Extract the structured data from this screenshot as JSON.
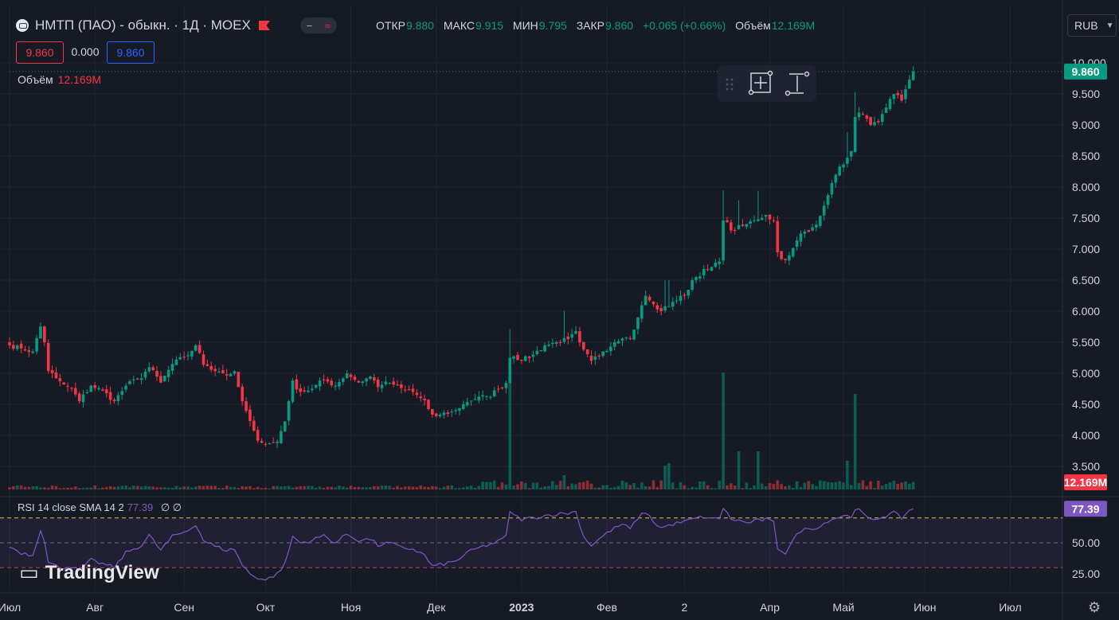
{
  "header": {
    "title": "НМТП (ПАО) - обыкн. · 1Д · MOEX",
    "indicator_pill": {
      "left_glyph": "−",
      "right_glyph": "≈"
    },
    "ohlc": {
      "open_label": "ОТКР",
      "open": "9.880",
      "high_label": "МАКС",
      "high": "9.915",
      "low_label": "МИН",
      "low": "9.795",
      "close_label": "ЗАКР",
      "close": "9.860",
      "change": "+0.065 (+0.66%)",
      "volume_label": "Объём",
      "volume": "12.169M"
    },
    "bid": "9.860",
    "spread": "0.000",
    "ask": "9.860",
    "currency": "RUB",
    "currency_icon": "chevron-down-icon"
  },
  "volume_legend": {
    "label": "Объём",
    "value": "12.169M"
  },
  "rsi_legend": {
    "text": "RSI 14 close SMA 14 2",
    "value": "77.39",
    "tail": "∅ ∅"
  },
  "branding": {
    "name": "TradingView",
    "icon": "tradingview-logo"
  },
  "colors": {
    "up": "#089981",
    "down": "#f23645",
    "rsi": "#7e57c2",
    "bg": "#161a25"
  },
  "chart_data": [
    {
      "type": "candlestick",
      "title": "НМТП (ПАО) - обыкн. · 1Д · MOEX",
      "ylim": [
        3.1,
        10.1
      ],
      "y_ticks": [
        "10.000",
        "9.500",
        "9.000",
        "8.500",
        "8.000",
        "7.500",
        "7.000",
        "6.500",
        "6.000",
        "5.500",
        "5.000",
        "4.500",
        "4.000",
        "3.500"
      ],
      "y_tick_values": [
        10,
        9.5,
        9,
        8.5,
        8,
        7.5,
        7,
        6.5,
        6,
        5.5,
        5,
        4.5,
        4,
        3.5
      ],
      "x_ticks": [
        "Июл",
        "Авг",
        "Сен",
        "Окт",
        "Ноя",
        "Дек",
        "2023",
        "Фев",
        "2",
        "Апр",
        "Май",
        "Июн",
        "Июл"
      ],
      "x_tick_days": [
        0,
        22,
        45,
        66,
        88,
        110,
        132,
        154,
        174,
        196,
        215,
        236,
        258
      ],
      "last_price_label": "9.860",
      "last_volume_label": "12.169M",
      "anchors": [
        [
          0,
          5.45
        ],
        [
          3,
          5.4
        ],
        [
          6,
          5.35
        ],
        [
          8,
          5.75
        ],
        [
          9,
          5.5
        ],
        [
          10,
          5.05
        ],
        [
          13,
          4.85
        ],
        [
          16,
          4.75
        ],
        [
          18,
          4.55
        ],
        [
          21,
          4.8
        ],
        [
          24,
          4.72
        ],
        [
          27,
          4.55
        ],
        [
          30,
          4.8
        ],
        [
          34,
          4.95
        ],
        [
          36,
          5.1
        ],
        [
          39,
          4.85
        ],
        [
          42,
          5.15
        ],
        [
          46,
          5.3
        ],
        [
          48,
          5.45
        ],
        [
          50,
          5.15
        ],
        [
          53,
          5.05
        ],
        [
          56,
          4.98
        ],
        [
          58,
          5.0
        ],
        [
          60,
          4.55
        ],
        [
          62,
          4.2
        ],
        [
          64,
          3.95
        ],
        [
          66,
          3.85
        ],
        [
          69,
          3.9
        ],
        [
          71,
          4.25
        ],
        [
          73,
          4.85
        ],
        [
          75,
          4.7
        ],
        [
          78,
          4.75
        ],
        [
          81,
          4.9
        ],
        [
          84,
          4.8
        ],
        [
          87,
          5.0
        ],
        [
          90,
          4.85
        ],
        [
          93,
          4.95
        ],
        [
          95,
          4.8
        ],
        [
          98,
          4.85
        ],
        [
          101,
          4.75
        ],
        [
          104,
          4.7
        ],
        [
          107,
          4.55
        ],
        [
          109,
          4.3
        ],
        [
          112,
          4.35
        ],
        [
          115,
          4.4
        ],
        [
          118,
          4.55
        ],
        [
          121,
          4.6
        ],
        [
          124,
          4.65
        ],
        [
          126,
          4.75
        ],
        [
          128,
          4.85
        ],
        [
          129,
          5.25
        ],
        [
          130,
          5.3
        ],
        [
          132,
          5.2
        ],
        [
          135,
          5.3
        ],
        [
          138,
          5.45
        ],
        [
          141,
          5.5
        ],
        [
          144,
          5.55
        ],
        [
          146,
          5.65
        ],
        [
          148,
          5.35
        ],
        [
          150,
          5.2
        ],
        [
          152,
          5.3
        ],
        [
          155,
          5.45
        ],
        [
          158,
          5.6
        ],
        [
          160,
          5.55
        ],
        [
          162,
          5.9
        ],
        [
          164,
          6.25
        ],
        [
          166,
          6.1
        ],
        [
          168,
          6.0
        ],
        [
          171,
          6.15
        ],
        [
          174,
          6.25
        ],
        [
          176,
          6.5
        ],
        [
          179,
          6.65
        ],
        [
          181,
          6.7
        ],
        [
          183,
          6.8
        ],
        [
          184,
          7.5
        ],
        [
          186,
          7.3
        ],
        [
          188,
          7.35
        ],
        [
          190,
          7.4
        ],
        [
          193,
          7.5
        ],
        [
          195,
          7.55
        ],
        [
          197,
          7.45
        ],
        [
          198,
          6.95
        ],
        [
          200,
          6.8
        ],
        [
          202,
          7.0
        ],
        [
          204,
          7.25
        ],
        [
          207,
          7.35
        ],
        [
          209,
          7.5
        ],
        [
          211,
          7.9
        ],
        [
          213,
          8.2
        ],
        [
          215,
          8.4
        ],
        [
          217,
          8.55
        ],
        [
          218,
          9.1
        ],
        [
          219,
          9.2
        ],
        [
          222,
          9.0
        ],
        [
          224,
          9.05
        ],
        [
          226,
          9.3
        ],
        [
          228,
          9.5
        ],
        [
          230,
          9.4
        ],
        [
          232,
          9.75
        ],
        [
          233,
          9.86
        ]
      ],
      "volume_spikes": [
        [
          129,
          4.6
        ],
        [
          184,
          4.9
        ],
        [
          218,
          4.0
        ],
        [
          188,
          1.6
        ],
        [
          193,
          1.6
        ],
        [
          216,
          1.2
        ],
        [
          169,
          1.0
        ],
        [
          170,
          1.1
        ],
        [
          143,
          0.6
        ]
      ],
      "volume_axis_scale": 10
    },
    {
      "type": "line",
      "title": "RSI 14 close SMA 14 2",
      "ylim": [
        15,
        90
      ],
      "y_ticks": [
        "50.00",
        "25.00"
      ],
      "y_tick_values": [
        50,
        25
      ],
      "bands": [
        70,
        50,
        30
      ],
      "last_value_label": "77.39",
      "anchors": [
        [
          0,
          47
        ],
        [
          3,
          42
        ],
        [
          6,
          40
        ],
        [
          8,
          61
        ],
        [
          9,
          52
        ],
        [
          10,
          34
        ],
        [
          13,
          30
        ],
        [
          16,
          31
        ],
        [
          18,
          27
        ],
        [
          21,
          36
        ],
        [
          24,
          33
        ],
        [
          27,
          30
        ],
        [
          30,
          42
        ],
        [
          34,
          48
        ],
        [
          36,
          56
        ],
        [
          39,
          44
        ],
        [
          42,
          55
        ],
        [
          46,
          60
        ],
        [
          48,
          65
        ],
        [
          50,
          52
        ],
        [
          53,
          47
        ],
        [
          56,
          44
        ],
        [
          58,
          45
        ],
        [
          60,
          32
        ],
        [
          62,
          25
        ],
        [
          64,
          22
        ],
        [
          66,
          20
        ],
        [
          69,
          25
        ],
        [
          71,
          33
        ],
        [
          73,
          55
        ],
        [
          75,
          50
        ],
        [
          78,
          52
        ],
        [
          81,
          56
        ],
        [
          84,
          50
        ],
        [
          87,
          57
        ],
        [
          90,
          52
        ],
        [
          93,
          53
        ],
        [
          95,
          48
        ],
        [
          98,
          50
        ],
        [
          101,
          46
        ],
        [
          104,
          45
        ],
        [
          107,
          40
        ],
        [
          109,
          31
        ],
        [
          112,
          33
        ],
        [
          115,
          35
        ],
        [
          118,
          42
        ],
        [
          121,
          46
        ],
        [
          124,
          49
        ],
        [
          126,
          51
        ],
        [
          128,
          55
        ],
        [
          129,
          76
        ],
        [
          130,
          72
        ],
        [
          132,
          69
        ],
        [
          135,
          70
        ],
        [
          138,
          72
        ],
        [
          141,
          73
        ],
        [
          144,
          74
        ],
        [
          146,
          75
        ],
        [
          148,
          55
        ],
        [
          150,
          48
        ],
        [
          152,
          53
        ],
        [
          155,
          60
        ],
        [
          158,
          65
        ],
        [
          160,
          61
        ],
        [
          162,
          70
        ],
        [
          164,
          75
        ],
        [
          166,
          67
        ],
        [
          168,
          62
        ],
        [
          171,
          65
        ],
        [
          174,
          67
        ],
        [
          176,
          69
        ],
        [
          179,
          71
        ],
        [
          181,
          69
        ],
        [
          183,
          70
        ],
        [
          184,
          78
        ],
        [
          186,
          69
        ],
        [
          188,
          68
        ],
        [
          190,
          66
        ],
        [
          193,
          68
        ],
        [
          195,
          69
        ],
        [
          197,
          66
        ],
        [
          198,
          46
        ],
        [
          200,
          42
        ],
        [
          202,
          52
        ],
        [
          204,
          60
        ],
        [
          207,
          62
        ],
        [
          209,
          63
        ],
        [
          211,
          68
        ],
        [
          213,
          70
        ],
        [
          215,
          72
        ],
        [
          217,
          71
        ],
        [
          218,
          78
        ],
        [
          219,
          76
        ],
        [
          222,
          68
        ],
        [
          224,
          70
        ],
        [
          226,
          72
        ],
        [
          228,
          74
        ],
        [
          230,
          70
        ],
        [
          232,
          76
        ],
        [
          233,
          77.39
        ]
      ]
    }
  ]
}
